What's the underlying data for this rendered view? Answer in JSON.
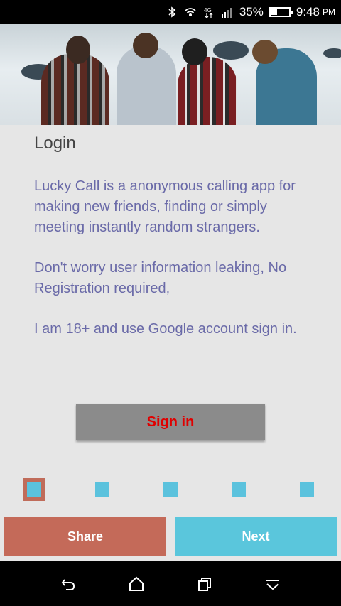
{
  "status_bar": {
    "battery_percent": "35%",
    "time": "9:48",
    "ampm": "PM",
    "network": "4G",
    "icons": [
      "bluetooth-icon",
      "wifi-icon",
      "network-4g-icon",
      "signal-icon",
      "battery-icon"
    ]
  },
  "login": {
    "title": "Login",
    "paragraph1": "Lucky Call is a anonymous calling app for making new friends, finding or simply meeting instantly random strangers.",
    "paragraph2": "Don't worry user information leaking, No Registration required,",
    "paragraph3": "I am 18+ and use Google account sign in.",
    "signin_label": "Sign in"
  },
  "pager": {
    "count": 5,
    "active_index": 0
  },
  "actions": {
    "share_label": "Share",
    "next_label": "Next"
  },
  "colors": {
    "accent_blue": "#5ac6dc",
    "accent_red": "#c46a59",
    "signin_text": "#e00000",
    "body_text": "#6a6aa8"
  },
  "nav_bar": {
    "icons": [
      "back-icon",
      "home-icon",
      "recents-icon",
      "menu-down-icon"
    ]
  }
}
